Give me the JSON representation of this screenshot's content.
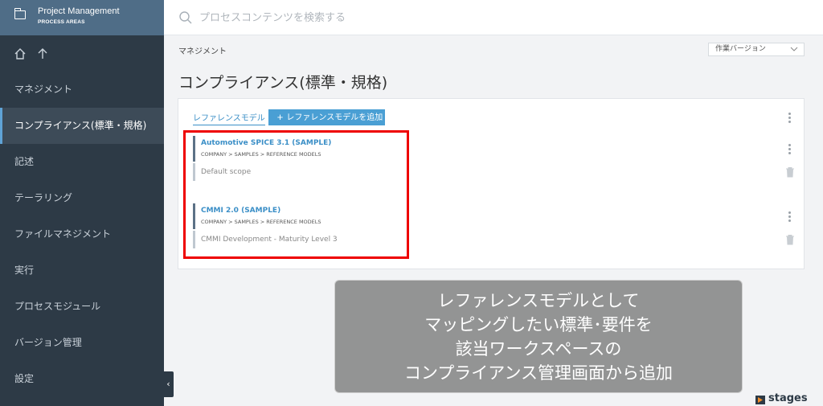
{
  "sidebar": {
    "title": "Project Management",
    "subtitle": "PROCESS AREAS",
    "items": [
      {
        "label": "マネジメント",
        "active": false
      },
      {
        "label": "コンプライアンス(標準・規格)",
        "active": true
      },
      {
        "label": "記述",
        "active": false
      },
      {
        "label": "テーラリング",
        "active": false
      },
      {
        "label": "ファイルマネジメント",
        "active": false
      },
      {
        "label": "実行",
        "active": false
      },
      {
        "label": "プロセスモジュール",
        "active": false
      },
      {
        "label": "バージョン管理",
        "active": false
      },
      {
        "label": "設定",
        "active": false
      }
    ],
    "collapse_label": "‹"
  },
  "search": {
    "placeholder": "プロセスコンテンツを検索する"
  },
  "breadcrumb": "マネジメント",
  "version_select": {
    "value": "作業バージョン"
  },
  "page_title": "コンプライアンス(標準・規格)",
  "card": {
    "tab_label": "レファレンスモデル",
    "add_button_label": "レファレンスモデルを追加",
    "models": [
      {
        "name": "Automotive SPICE 3.1 (SAMPLE)",
        "path": "COMPANY > SAMPLES > REFERENCE MODELS",
        "scope": "Default scope"
      },
      {
        "name": "CMMI 2.0 (SAMPLE)",
        "path": "COMPANY > SAMPLES > REFERENCE MODELS",
        "scope": "CMMI Development - Maturity Level 3"
      }
    ]
  },
  "callout": {
    "lines": [
      "レファレンスモデルとして",
      "マッピングしたい標準･要件を",
      "該当ワークスペースの",
      "コンプライアンス管理画面から追加"
    ]
  },
  "logo": {
    "text": "stages"
  },
  "colors": {
    "sidebar": "#2d3a46",
    "sidebar_header": "#4f6d87",
    "accent": "#4a9fd4",
    "highlight": "#ee0000"
  }
}
